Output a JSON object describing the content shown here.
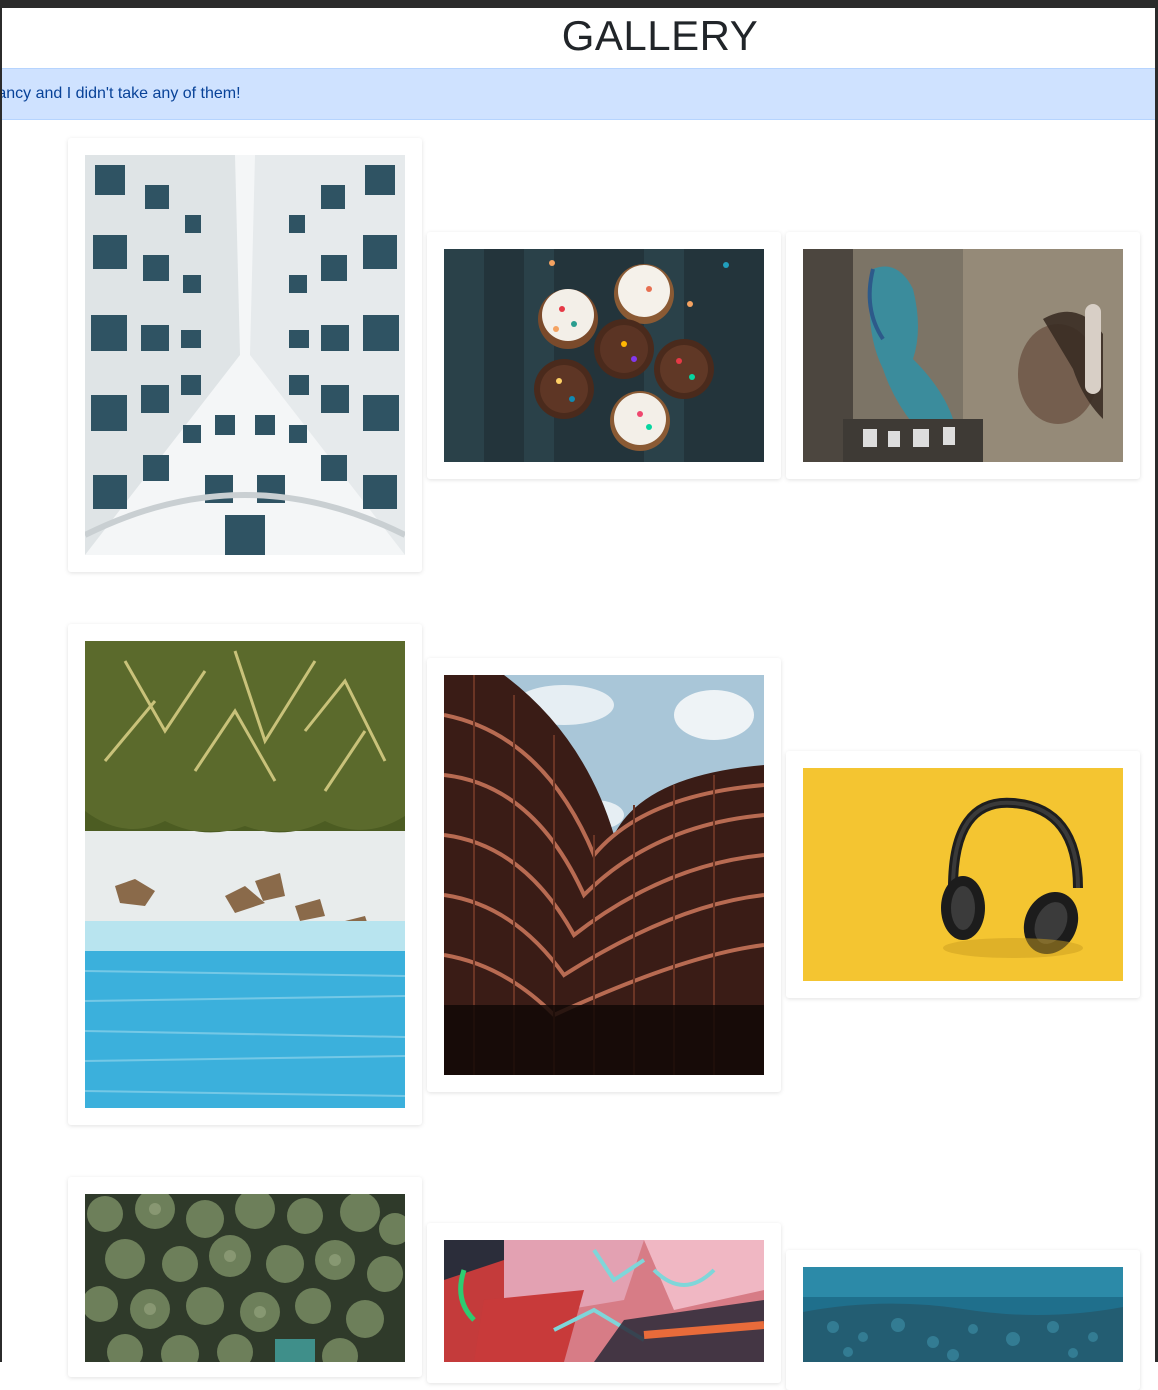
{
  "page": {
    "title": "GALLERY",
    "banner_text": "os are fancy and I didn't take any of them!"
  },
  "colors": {
    "banner_bg": "#cfe2ff",
    "banner_text": "#084298",
    "title": "#212529"
  },
  "gallery": {
    "photos": [
      {
        "subject": "building-facade-looking-up"
      },
      {
        "subject": "cupcakes-with-sprinkles"
      },
      {
        "subject": "street-art-and-person-with-headphones"
      },
      {
        "subject": "aerial-palm-trees-and-beach"
      },
      {
        "subject": "wavy-modern-building"
      },
      {
        "subject": "headphones-on-yellow"
      },
      {
        "subject": "aerial-palm-forest"
      },
      {
        "subject": "colorful-graffiti"
      },
      {
        "subject": "aerial-ocean-reef"
      }
    ]
  }
}
